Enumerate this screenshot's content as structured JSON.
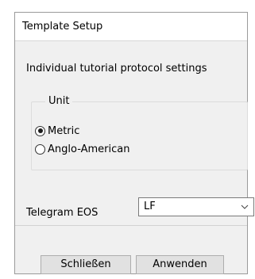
{
  "window": {
    "title": "Template Setup"
  },
  "main": {
    "subtitle": "Individual tutorial protocol settings",
    "unit_group": {
      "legend": "Unit",
      "options": [
        {
          "label": "Metric",
          "checked": true
        },
        {
          "label": "Anglo-American",
          "checked": false
        }
      ]
    },
    "eos": {
      "label": "Telegram EOS",
      "selected": "LF",
      "icon": "chevron-down-icon"
    }
  },
  "buttons": {
    "close_label": "Schließen",
    "apply_label": "Anwenden"
  },
  "colors": {
    "dialog_background": "#f0f0f0",
    "title_background": "#ffffff",
    "button_background": "#e1e1e1"
  }
}
